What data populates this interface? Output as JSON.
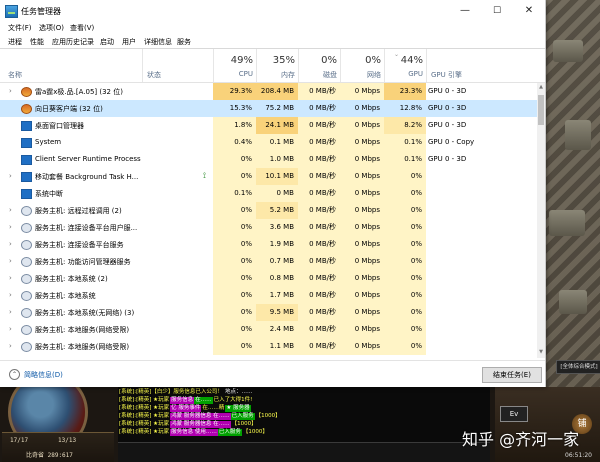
{
  "window": {
    "title": "任务管理器",
    "minimize": "—",
    "maximize": "☐",
    "close": "✕"
  },
  "menu": [
    "文件(F)",
    "选项(O)",
    "查看(V)"
  ],
  "tabs": [
    "进程",
    "性能",
    "应用历史记录",
    "启动",
    "用户",
    "详细信息",
    "服务"
  ],
  "columns": {
    "name": "名称",
    "status": "状态",
    "cpu": {
      "pct": "49%",
      "label": "CPU"
    },
    "mem": {
      "pct": "35%",
      "label": "内存"
    },
    "disk": {
      "pct": "0%",
      "label": "磁盘"
    },
    "net": {
      "pct": "0%",
      "label": "网络"
    },
    "gpu": {
      "pct": "44%",
      "label": "GPU"
    },
    "gpu_engine": "GPU 引擎",
    "sort_caret": "⌄"
  },
  "colors": {
    "heat_high": "#f9d27a",
    "heat_mid": "#fde8a8",
    "heat_low": "#fff4c6",
    "selected": "#cce8ff",
    "link": "#0b57a6"
  },
  "rows": [
    {
      "chev": "›",
      "icon": "app",
      "name": "雷a霆x极.品.[A.05] (32 位)",
      "cpu": "29.3%",
      "mem": "208.4 MB",
      "disk": "0 MB/秒",
      "net": "0 Mbps",
      "gpu": "23.3%",
      "engine": "GPU 0 - 3D"
    },
    {
      "chev": "",
      "icon": "app",
      "name": "向日葵客户端 (32 位)",
      "cpu": "15.3%",
      "mem": "75.2 MB",
      "disk": "0 MB/秒",
      "net": "0 Mbps",
      "gpu": "12.8%",
      "engine": "GPU 0 - 3D"
    },
    {
      "chev": "",
      "icon": "win",
      "name": "桌面窗口管理器",
      "cpu": "1.8%",
      "mem": "24.1 MB",
      "disk": "0 MB/秒",
      "net": "0 Mbps",
      "gpu": "8.2%",
      "engine": "GPU 0 - 3D"
    },
    {
      "chev": "",
      "icon": "win",
      "name": "System",
      "cpu": "0.4%",
      "mem": "0.1 MB",
      "disk": "0 MB/秒",
      "net": "0 Mbps",
      "gpu": "0.1%",
      "engine": "GPU 0 - Copy"
    },
    {
      "chev": "",
      "icon": "win",
      "name": "Client Server Runtime Process",
      "cpu": "0%",
      "mem": "1.0 MB",
      "disk": "0 MB/秒",
      "net": "0 Mbps",
      "gpu": "0.1%",
      "engine": "GPU 0 - 3D"
    },
    {
      "chev": "›",
      "icon": "win",
      "name": "移动套餐 Background Task H...",
      "cpu": "0%",
      "mem": "10.1 MB",
      "disk": "0 MB/秒",
      "net": "0 Mbps",
      "gpu": "0%",
      "engine": "",
      "leaf": "⟟"
    },
    {
      "chev": "",
      "icon": "win",
      "name": "系统中断",
      "cpu": "0.1%",
      "mem": "0 MB",
      "disk": "0 MB/秒",
      "net": "0 Mbps",
      "gpu": "0%",
      "engine": ""
    },
    {
      "chev": "›",
      "icon": "gear",
      "name": "服务主机: 远程过程调用 (2)",
      "cpu": "0%",
      "mem": "5.2 MB",
      "disk": "0 MB/秒",
      "net": "0 Mbps",
      "gpu": "0%",
      "engine": ""
    },
    {
      "chev": "›",
      "icon": "gear",
      "name": "服务主机: 连接设备平台用户服...",
      "cpu": "0%",
      "mem": "3.6 MB",
      "disk": "0 MB/秒",
      "net": "0 Mbps",
      "gpu": "0%",
      "engine": ""
    },
    {
      "chev": "›",
      "icon": "gear",
      "name": "服务主机: 连接设备平台服务",
      "cpu": "0%",
      "mem": "1.9 MB",
      "disk": "0 MB/秒",
      "net": "0 Mbps",
      "gpu": "0%",
      "engine": ""
    },
    {
      "chev": "›",
      "icon": "gear",
      "name": "服务主机: 功能访问管理器服务",
      "cpu": "0%",
      "mem": "0.7 MB",
      "disk": "0 MB/秒",
      "net": "0 Mbps",
      "gpu": "0%",
      "engine": ""
    },
    {
      "chev": "›",
      "icon": "gear",
      "name": "服务主机: 本地系统 (2)",
      "cpu": "0%",
      "mem": "0.8 MB",
      "disk": "0 MB/秒",
      "net": "0 Mbps",
      "gpu": "0%",
      "engine": ""
    },
    {
      "chev": "›",
      "icon": "gear",
      "name": "服务主机: 本地系统",
      "cpu": "0%",
      "mem": "1.7 MB",
      "disk": "0 MB/秒",
      "net": "0 Mbps",
      "gpu": "0%",
      "engine": ""
    },
    {
      "chev": "›",
      "icon": "gear",
      "name": "服务主机: 本地系统(无网络) (3)",
      "cpu": "0%",
      "mem": "9.5 MB",
      "disk": "0 MB/秒",
      "net": "0 Mbps",
      "gpu": "0%",
      "engine": ""
    },
    {
      "chev": "›",
      "icon": "gear",
      "name": "服务主机: 本地服务(网络受限)",
      "cpu": "0%",
      "mem": "2.4 MB",
      "disk": "0 MB/秒",
      "net": "0 Mbps",
      "gpu": "0%",
      "engine": ""
    },
    {
      "chev": "›",
      "icon": "gear",
      "name": "服务主机: 本地服务(网络受限)",
      "cpu": "0%",
      "mem": "1.1 MB",
      "disk": "0 MB/秒",
      "net": "0 Mbps",
      "gpu": "0%",
      "engine": ""
    }
  ],
  "selected_row": 1,
  "footer": {
    "less_details": "简略信息(D)",
    "toggle_icon": "⌃",
    "end_task": "结束任务(E)"
  },
  "game": {
    "hp_left": "17/17",
    "hp_right": "13/13",
    "status_line": "比奇省 289:617",
    "hud_badge": "Ev",
    "map_label": "[全体综合模式]",
    "clock": "06:51:20",
    "knob": "铺",
    "watermark": "知乎 @齐河一家"
  },
  "chat": [
    [
      [
        "y",
        "[系统]:[精英]【白少】服务信息已入公司！"
      ],
      [
        "wht",
        "   地点：……"
      ]
    ],
    [
      [
        "y",
        "[系统]:[精英] ★玩家 "
      ],
      [
        "mag",
        "服务信息"
      ],
      [
        "grn",
        "在……"
      ],
      [
        "y",
        " 已入了大得1件!"
      ]
    ],
    [
      [
        "y",
        "[系统]:[精英] ★玩家 "
      ],
      [
        "mag",
        "亿 服务事件"
      ],
      [
        "y",
        " 在……精 "
      ],
      [
        "grn",
        "★ 服务器"
      ]
    ],
    [
      [
        "y",
        "[系统]:[精英] ★玩家 "
      ],
      [
        "mag",
        "鸿蒙 服务器信息 在……"
      ],
      [
        "grn",
        " 已入服务"
      ],
      [
        "y",
        "【1000】"
      ]
    ],
    [
      [
        "y",
        "[系统]:[精英] ★玩家 "
      ],
      [
        "mag",
        "鸿蒙 服务器信息 在……"
      ],
      [
        "y",
        "【1000】"
      ]
    ],
    [
      [
        "y",
        "[系统]:[精英] ★玩家 "
      ],
      [
        "mag",
        "服务信息 使用……"
      ],
      [
        "grn",
        "已入服务"
      ],
      [
        "y",
        "【1000】"
      ]
    ]
  ]
}
